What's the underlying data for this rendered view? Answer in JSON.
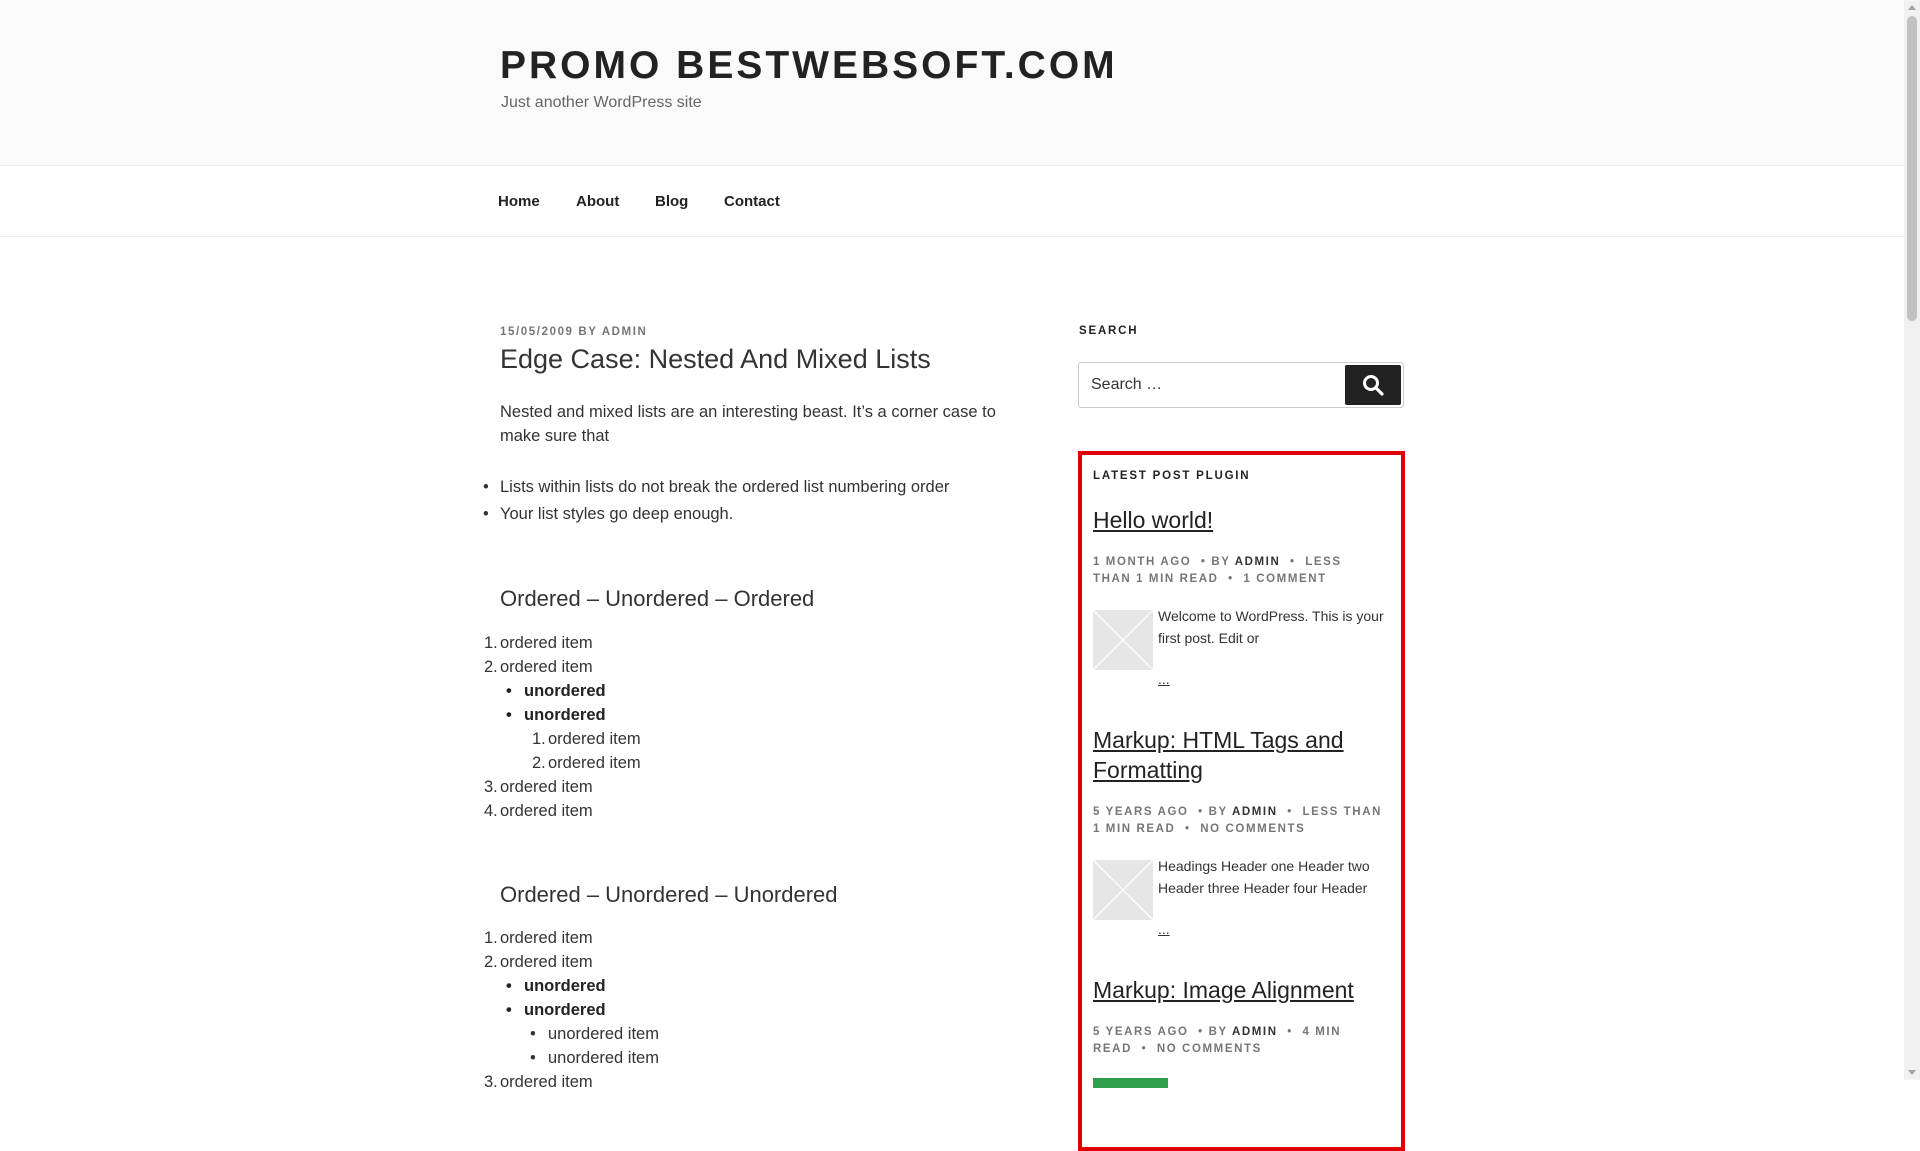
{
  "site": {
    "title": "PROMO BESTWEBSOFT.COM",
    "description": "Just another WordPress site"
  },
  "nav": {
    "items": [
      {
        "label": "Home"
      },
      {
        "label": "About"
      },
      {
        "label": "Blog"
      },
      {
        "label": "Contact"
      }
    ]
  },
  "post": {
    "date": "15/05/2009",
    "by": "BY",
    "author": "ADMIN",
    "title": "Edge Case: Nested And Mixed Lists",
    "intro": "Nested and mixed lists are an interesting beast. It’s a corner case to make sure that",
    "intro_list": [
      "Lists within lists do not break the ordered list numbering order",
      "Your list styles go deep enough."
    ],
    "sections": [
      {
        "heading": "Ordered – Unordered – Ordered",
        "items": [
          {
            "marker": "1.",
            "text": "ordered item"
          },
          {
            "marker": "2.",
            "text": "ordered item"
          },
          {
            "marker": "•",
            "text": "unordered"
          },
          {
            "marker": "•",
            "text": "unordered"
          },
          {
            "marker": "1.",
            "text": "ordered item"
          },
          {
            "marker": "2.",
            "text": "ordered item"
          },
          {
            "marker": "3.",
            "text": "ordered item"
          },
          {
            "marker": "4.",
            "text": "ordered item"
          }
        ]
      },
      {
        "heading": "Ordered – Unordered – Unordered",
        "items": [
          {
            "marker": "1.",
            "text": "ordered item"
          },
          {
            "marker": "2.",
            "text": "ordered item"
          },
          {
            "marker": "•",
            "text": "unordered"
          },
          {
            "marker": "•",
            "text": "unordered"
          },
          {
            "marker": "•",
            "text": "unordered item"
          },
          {
            "marker": "•",
            "text": "unordered item"
          },
          {
            "marker": "3.",
            "text": "ordered item"
          }
        ]
      }
    ]
  },
  "sidebar": {
    "search": {
      "title": "SEARCH",
      "placeholder": "Search …",
      "button_icon": "search-icon"
    },
    "latest_posts": {
      "title": "LATEST POST PLUGIN",
      "posts": [
        {
          "title": "Hello world!",
          "age": "1 MONTH AGO",
          "by": "BY",
          "author": "ADMIN",
          "read": "LESS THAN 1 MIN READ",
          "comments": "1 COMMENT",
          "excerpt": "Welcome to WordPress. This is your first post. Edit or",
          "more": "..."
        },
        {
          "title": "Markup: HTML Tags and Formatting",
          "age": "5 YEARS AGO",
          "by": "BY",
          "author": "ADMIN",
          "read": "LESS THAN 1 MIN READ",
          "comments": "NO COMMENTS",
          "excerpt": "Headings Header one Header two Header three Header four Header",
          "more": "..."
        },
        {
          "title": "Markup: Image Alignment",
          "age": "5 YEARS AGO",
          "by": "BY",
          "author": "ADMIN",
          "read": "4 MIN READ",
          "comments": "NO COMMENTS",
          "excerpt": "",
          "more": ""
        }
      ]
    }
  },
  "colors": {
    "highlight_border": "#e00000",
    "button_bg": "#222222",
    "header_bg": "#fafafa"
  }
}
